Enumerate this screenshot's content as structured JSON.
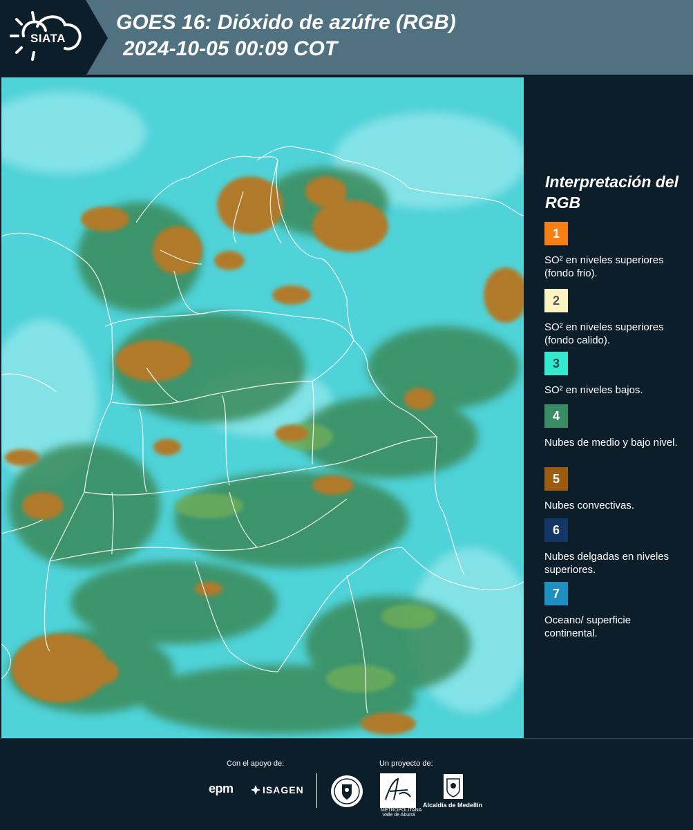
{
  "header": {
    "logo_text": "SIATA",
    "title_line1": "GOES 16: Dióxido de azúfre (RGB)",
    "title_line2": "2024-10-05 00:09 COT"
  },
  "legend": {
    "title": "Interpretación del RGB",
    "items": [
      {
        "number": "1",
        "label": "SO² en niveles superiores (fondo frio).",
        "color": "#f57f14"
      },
      {
        "number": "2",
        "label": "SO² en niveles superiores (fondo calido).",
        "color": "#fbf4c0"
      },
      {
        "number": "3",
        "label": "SO² en niveles bajos.",
        "color": "#33e9cf"
      },
      {
        "number": "4",
        "label": "Nubes de medio y bajo nivel.",
        "color": "#3a8c64"
      },
      {
        "number": "5",
        "label": "Nubes convectivas.",
        "color": "#9b5c12"
      },
      {
        "number": "6",
        "label": "Nubes delgadas en niveles superiores.",
        "color": "#133667"
      },
      {
        "number": "7",
        "label": "Oceano/ superficie continental.",
        "color": "#1d8fc0"
      }
    ]
  },
  "footer": {
    "support_label": "Con el apoyo de:",
    "project_label": "Un proyecto de:",
    "epm": "epm",
    "isagen": "ISAGEN",
    "area_metropolitana": "METROPOLITANA Valle de Aburrá",
    "alcaldia": "Alcaldía de Medellín"
  },
  "colors": {
    "background": "#0d1e2b",
    "header_band": "#4f7180",
    "sea_cyan": "#4fd2d8",
    "cloud_green": "#3f8f56",
    "convective_brown": "#b07a2c"
  }
}
